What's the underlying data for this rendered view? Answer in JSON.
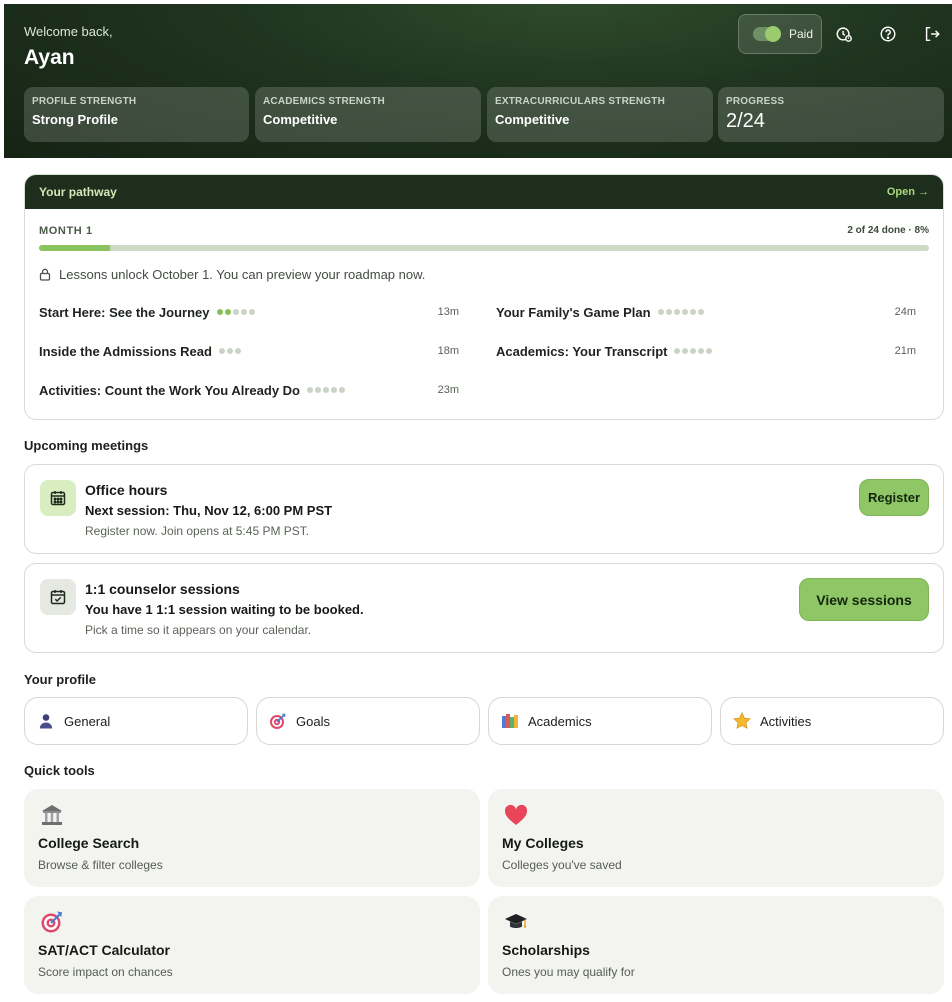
{
  "header": {
    "welcome": "Welcome back,",
    "user_name": "Ayan",
    "plan_label": "Paid",
    "stats": [
      {
        "label": "PROFILE STRENGTH",
        "value": "Strong Profile"
      },
      {
        "label": "ACADEMICS STRENGTH",
        "value": "Competitive"
      },
      {
        "label": "EXTRACURRICULARS STRENGTH",
        "value": "Competitive"
      },
      {
        "label": "PROGRESS",
        "value": "2/24"
      }
    ]
  },
  "pathway": {
    "title": "Your pathway",
    "open_label": "Open →",
    "month_label": "MONTH 1",
    "progress_text": "2 of 24 done · 8%",
    "progress_fraction": 0.08,
    "unlock_note": "Lessons unlock October 1. You can preview your roadmap now.",
    "lessons": [
      {
        "title": "Start Here: See the Journey",
        "duration": "13m",
        "dots_total": 5,
        "dots_done": 2
      },
      {
        "title": "Your Family's Game Plan",
        "duration": "24m",
        "dots_total": 6,
        "dots_done": 0
      },
      {
        "title": "Inside the Admissions Read",
        "duration": "18m",
        "dots_total": 3,
        "dots_done": 0
      },
      {
        "title": "Academics: Your Transcript",
        "duration": "21m",
        "dots_total": 5,
        "dots_done": 0
      },
      {
        "title": "Activities: Count the Work You Already Do",
        "duration": "23m",
        "dots_total": 5,
        "dots_done": 0
      }
    ]
  },
  "meetings": {
    "title": "Upcoming meetings",
    "office_hours": {
      "title": "Office hours",
      "line": "Next session: Thu, Nov 12, 6:00 PM PST",
      "sub": "Register now. Join opens at 5:45 PM PST.",
      "button": "Register"
    },
    "counselor": {
      "title": "1:1 counselor sessions",
      "line": "You have 1 1:1 session waiting to be booked.",
      "sub": "Pick a time so it appears on your calendar.",
      "button": "View sessions"
    }
  },
  "profile": {
    "title": "Your profile",
    "items": [
      {
        "label": "General",
        "icon": "person-icon"
      },
      {
        "label": "Goals",
        "icon": "target-icon"
      },
      {
        "label": "Academics",
        "icon": "books-icon"
      },
      {
        "label": "Activities",
        "icon": "star-icon"
      }
    ]
  },
  "tools": {
    "title": "Quick tools",
    "items": [
      {
        "title": "College Search",
        "sub": "Browse & filter colleges",
        "icon": "building-icon"
      },
      {
        "title": "My Colleges",
        "sub": "Colleges you've saved",
        "icon": "heart-icon"
      },
      {
        "title": "SAT/ACT Calculator",
        "sub": "Score impact on chances",
        "icon": "target-icon"
      },
      {
        "title": "Scholarships",
        "sub": "Ones you may qualify for",
        "icon": "graduation-cap-icon"
      }
    ]
  },
  "colors": {
    "header_bg": "#1f331e",
    "accent_green": "#8fc666",
    "progress_fill": "#8ac45e"
  }
}
